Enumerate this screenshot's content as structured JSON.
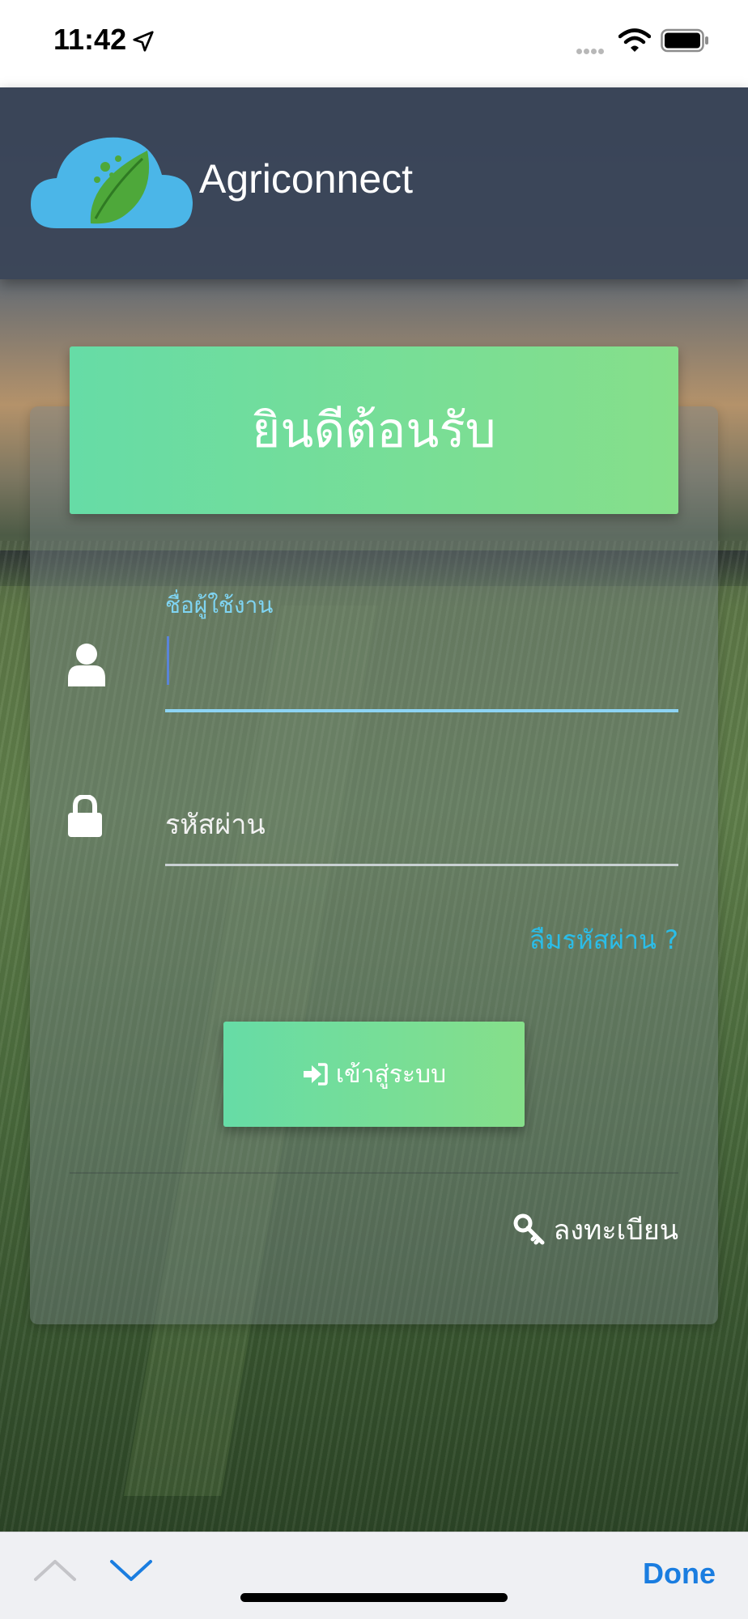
{
  "status_bar": {
    "time": "11:42",
    "icons": [
      "location-arrow-icon",
      "cellular-signal-icon",
      "wifi-icon",
      "battery-icon"
    ]
  },
  "header": {
    "app_name": "Agriconnect",
    "logo_icon": "cloud-leaf-logo"
  },
  "login_card": {
    "welcome_title": "ยินดีต้อนรับ",
    "username": {
      "label": "ชื่อผู้ใช้งาน",
      "value": "",
      "icon": "user-icon"
    },
    "password": {
      "placeholder": "รหัสผ่าน",
      "value": "",
      "icon": "lock-icon"
    },
    "forgot_password": "ลืมรหัสผ่าน ?",
    "login_button": {
      "label": "เข้าสู่ระบบ",
      "icon": "sign-in-icon"
    },
    "register_link": {
      "label": "ลงทะเบียน",
      "icon": "key-icon"
    }
  },
  "keyboard_accessory": {
    "done_label": "Done",
    "prev_icon": "chevron-up-icon",
    "next_icon": "chevron-down-icon"
  },
  "colors": {
    "accent_green": "#6fdc9f",
    "link_blue": "#2bbde8",
    "header_bg": "#374256",
    "done_blue": "#1a7de0"
  }
}
